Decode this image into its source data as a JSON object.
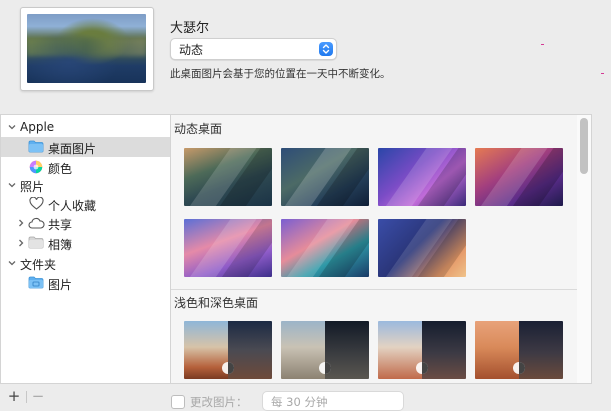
{
  "header": {
    "wallpaper_name": "大瑟尔",
    "mode_value": "动态",
    "description": "此桌面图片会基于您的位置在一天中不断变化。"
  },
  "sidebar": {
    "groups": [
      {
        "label": "Apple",
        "expanded": true,
        "items": [
          {
            "label": "桌面图片",
            "icon": "folder-icon",
            "selected": true
          },
          {
            "label": "颜色",
            "icon": "color-wheel-icon",
            "selected": false
          }
        ]
      },
      {
        "label": "照片",
        "expanded": true,
        "items": [
          {
            "label": "个人收藏",
            "icon": "heart-icon",
            "expandable": false
          },
          {
            "label": "共享",
            "icon": "cloud-icon",
            "expandable": true
          },
          {
            "label": "相簿",
            "icon": "folder-icon",
            "expandable": true
          }
        ]
      },
      {
        "label": "文件夹",
        "expanded": true,
        "items": [
          {
            "label": "图片",
            "icon": "folder-icon",
            "expandable": false
          }
        ]
      }
    ]
  },
  "content": {
    "section_dynamic": "动态桌面",
    "section_light_dark": "浅色和深色桌面"
  },
  "footer": {
    "add_label": "+",
    "remove_label": "−",
    "change_picture_label": "更改图片：",
    "interval_value": "每 30 分钟"
  }
}
